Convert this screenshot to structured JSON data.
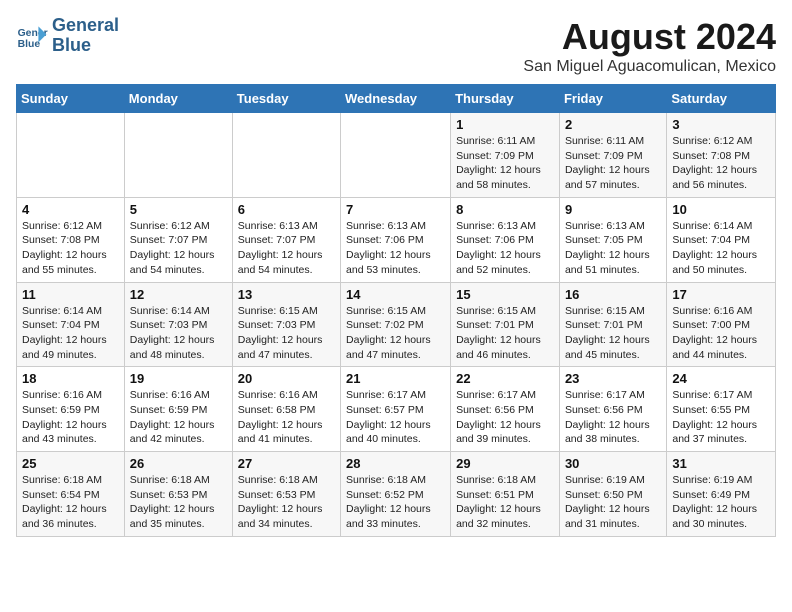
{
  "logo": {
    "line1": "General",
    "line2": "Blue"
  },
  "title": "August 2024",
  "location": "San Miguel Aguacomulican, Mexico",
  "days_of_week": [
    "Sunday",
    "Monday",
    "Tuesday",
    "Wednesday",
    "Thursday",
    "Friday",
    "Saturday"
  ],
  "weeks": [
    [
      {
        "day": "",
        "info": ""
      },
      {
        "day": "",
        "info": ""
      },
      {
        "day": "",
        "info": ""
      },
      {
        "day": "",
        "info": ""
      },
      {
        "day": "1",
        "info": "Sunrise: 6:11 AM\nSunset: 7:09 PM\nDaylight: 12 hours\nand 58 minutes."
      },
      {
        "day": "2",
        "info": "Sunrise: 6:11 AM\nSunset: 7:09 PM\nDaylight: 12 hours\nand 57 minutes."
      },
      {
        "day": "3",
        "info": "Sunrise: 6:12 AM\nSunset: 7:08 PM\nDaylight: 12 hours\nand 56 minutes."
      }
    ],
    [
      {
        "day": "4",
        "info": "Sunrise: 6:12 AM\nSunset: 7:08 PM\nDaylight: 12 hours\nand 55 minutes."
      },
      {
        "day": "5",
        "info": "Sunrise: 6:12 AM\nSunset: 7:07 PM\nDaylight: 12 hours\nand 54 minutes."
      },
      {
        "day": "6",
        "info": "Sunrise: 6:13 AM\nSunset: 7:07 PM\nDaylight: 12 hours\nand 54 minutes."
      },
      {
        "day": "7",
        "info": "Sunrise: 6:13 AM\nSunset: 7:06 PM\nDaylight: 12 hours\nand 53 minutes."
      },
      {
        "day": "8",
        "info": "Sunrise: 6:13 AM\nSunset: 7:06 PM\nDaylight: 12 hours\nand 52 minutes."
      },
      {
        "day": "9",
        "info": "Sunrise: 6:13 AM\nSunset: 7:05 PM\nDaylight: 12 hours\nand 51 minutes."
      },
      {
        "day": "10",
        "info": "Sunrise: 6:14 AM\nSunset: 7:04 PM\nDaylight: 12 hours\nand 50 minutes."
      }
    ],
    [
      {
        "day": "11",
        "info": "Sunrise: 6:14 AM\nSunset: 7:04 PM\nDaylight: 12 hours\nand 49 minutes."
      },
      {
        "day": "12",
        "info": "Sunrise: 6:14 AM\nSunset: 7:03 PM\nDaylight: 12 hours\nand 48 minutes."
      },
      {
        "day": "13",
        "info": "Sunrise: 6:15 AM\nSunset: 7:03 PM\nDaylight: 12 hours\nand 47 minutes."
      },
      {
        "day": "14",
        "info": "Sunrise: 6:15 AM\nSunset: 7:02 PM\nDaylight: 12 hours\nand 47 minutes."
      },
      {
        "day": "15",
        "info": "Sunrise: 6:15 AM\nSunset: 7:01 PM\nDaylight: 12 hours\nand 46 minutes."
      },
      {
        "day": "16",
        "info": "Sunrise: 6:15 AM\nSunset: 7:01 PM\nDaylight: 12 hours\nand 45 minutes."
      },
      {
        "day": "17",
        "info": "Sunrise: 6:16 AM\nSunset: 7:00 PM\nDaylight: 12 hours\nand 44 minutes."
      }
    ],
    [
      {
        "day": "18",
        "info": "Sunrise: 6:16 AM\nSunset: 6:59 PM\nDaylight: 12 hours\nand 43 minutes."
      },
      {
        "day": "19",
        "info": "Sunrise: 6:16 AM\nSunset: 6:59 PM\nDaylight: 12 hours\nand 42 minutes."
      },
      {
        "day": "20",
        "info": "Sunrise: 6:16 AM\nSunset: 6:58 PM\nDaylight: 12 hours\nand 41 minutes."
      },
      {
        "day": "21",
        "info": "Sunrise: 6:17 AM\nSunset: 6:57 PM\nDaylight: 12 hours\nand 40 minutes."
      },
      {
        "day": "22",
        "info": "Sunrise: 6:17 AM\nSunset: 6:56 PM\nDaylight: 12 hours\nand 39 minutes."
      },
      {
        "day": "23",
        "info": "Sunrise: 6:17 AM\nSunset: 6:56 PM\nDaylight: 12 hours\nand 38 minutes."
      },
      {
        "day": "24",
        "info": "Sunrise: 6:17 AM\nSunset: 6:55 PM\nDaylight: 12 hours\nand 37 minutes."
      }
    ],
    [
      {
        "day": "25",
        "info": "Sunrise: 6:18 AM\nSunset: 6:54 PM\nDaylight: 12 hours\nand 36 minutes."
      },
      {
        "day": "26",
        "info": "Sunrise: 6:18 AM\nSunset: 6:53 PM\nDaylight: 12 hours\nand 35 minutes."
      },
      {
        "day": "27",
        "info": "Sunrise: 6:18 AM\nSunset: 6:53 PM\nDaylight: 12 hours\nand 34 minutes."
      },
      {
        "day": "28",
        "info": "Sunrise: 6:18 AM\nSunset: 6:52 PM\nDaylight: 12 hours\nand 33 minutes."
      },
      {
        "day": "29",
        "info": "Sunrise: 6:18 AM\nSunset: 6:51 PM\nDaylight: 12 hours\nand 32 minutes."
      },
      {
        "day": "30",
        "info": "Sunrise: 6:19 AM\nSunset: 6:50 PM\nDaylight: 12 hours\nand 31 minutes."
      },
      {
        "day": "31",
        "info": "Sunrise: 6:19 AM\nSunset: 6:49 PM\nDaylight: 12 hours\nand 30 minutes."
      }
    ]
  ]
}
